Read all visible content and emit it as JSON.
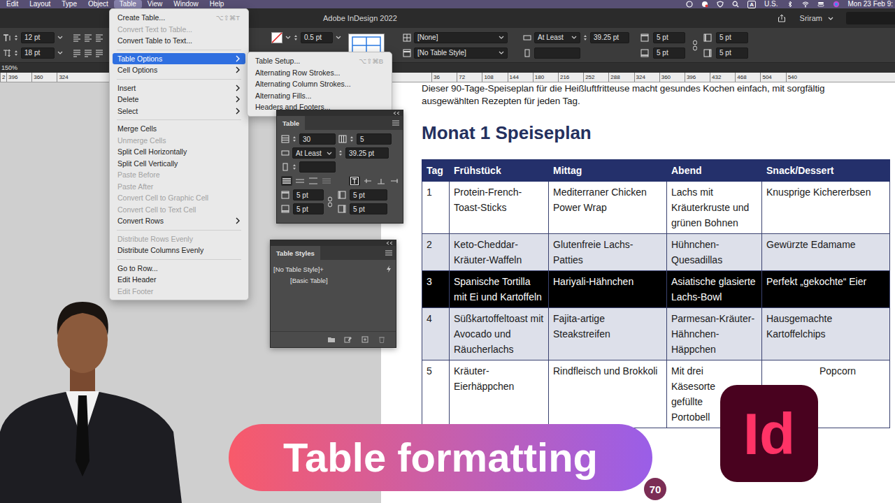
{
  "menubar": {
    "items": [
      {
        "label": "Edit",
        "selected": false
      },
      {
        "label": "Layout",
        "selected": false
      },
      {
        "label": "Type",
        "selected": false
      },
      {
        "label": "Object",
        "selected": false
      },
      {
        "label": "Table",
        "selected": true
      },
      {
        "label": "View",
        "selected": false
      },
      {
        "label": "Window",
        "selected": false
      },
      {
        "label": "Help",
        "selected": false
      }
    ],
    "status": {
      "input_source": "A",
      "locale": "U.S.",
      "clock": "Mon 23 Feb 9:"
    }
  },
  "app_bar": {
    "title": "Adobe InDesign 2022",
    "user": "Sriram"
  },
  "control_panel": {
    "font_size": "12 pt",
    "leading": "18 pt",
    "stroke_weight": "0.5 pt",
    "cell_style": "[None]",
    "table_style": "[No Table Style]",
    "row_height_mode": "At Least",
    "row_height": "39.25 pt",
    "row_height_max": "",
    "insets": [
      "5 pt",
      "5 pt",
      "5 pt",
      "5 pt"
    ]
  },
  "zoom": "150%",
  "ruler": {
    "left": [
      "2",
      "396",
      "360",
      "324"
    ],
    "right": [
      "36",
      "72",
      "108",
      "144",
      "180",
      "216",
      "252",
      "288",
      "324",
      "360",
      "396",
      "432",
      "468",
      "504",
      "540"
    ]
  },
  "table_menu": {
    "groups": [
      [
        {
          "label": "Create Table...",
          "shortcut": "⌥⇧⌘T",
          "disabled": false,
          "submenu": false,
          "selected": false
        },
        {
          "label": "Convert Text to Table...",
          "disabled": true,
          "submenu": false,
          "selected": false
        },
        {
          "label": "Convert Table to Text...",
          "disabled": false,
          "submenu": false,
          "selected": false
        }
      ],
      [
        {
          "label": "Table Options",
          "disabled": false,
          "submenu": true,
          "selected": true
        },
        {
          "label": "Cell Options",
          "disabled": false,
          "submenu": true,
          "selected": false
        }
      ],
      [
        {
          "label": "Insert",
          "disabled": false,
          "submenu": true,
          "selected": false
        },
        {
          "label": "Delete",
          "disabled": false,
          "submenu": true,
          "selected": false
        },
        {
          "label": "Select",
          "disabled": false,
          "submenu": true,
          "selected": false
        }
      ],
      [
        {
          "label": "Merge Cells",
          "disabled": false,
          "submenu": false,
          "selected": false
        },
        {
          "label": "Unmerge Cells",
          "disabled": true,
          "submenu": false,
          "selected": false
        },
        {
          "label": "Split Cell Horizontally",
          "disabled": false,
          "submenu": false,
          "selected": false
        },
        {
          "label": "Split Cell Vertically",
          "disabled": false,
          "submenu": false,
          "selected": false
        },
        {
          "label": "Paste Before",
          "disabled": true,
          "submenu": false,
          "selected": false
        },
        {
          "label": "Paste After",
          "disabled": true,
          "submenu": false,
          "selected": false
        },
        {
          "label": "Convert Cell to Graphic Cell",
          "disabled": true,
          "submenu": false,
          "selected": false
        },
        {
          "label": "Convert Cell to Text Cell",
          "disabled": true,
          "submenu": false,
          "selected": false
        },
        {
          "label": "Convert Rows",
          "disabled": false,
          "submenu": true,
          "selected": false
        }
      ],
      [
        {
          "label": "Distribute Rows Evenly",
          "disabled": true,
          "submenu": false,
          "selected": false
        },
        {
          "label": "Distribute Columns Evenly",
          "disabled": false,
          "submenu": false,
          "selected": false
        }
      ],
      [
        {
          "label": "Go to Row...",
          "disabled": false,
          "submenu": false,
          "selected": false
        },
        {
          "label": "Edit Header",
          "disabled": false,
          "submenu": false,
          "selected": false
        },
        {
          "label": "Edit Footer",
          "disabled": true,
          "submenu": false,
          "selected": false
        }
      ]
    ]
  },
  "table_options_submenu": {
    "items": [
      {
        "label": "Table Setup...",
        "shortcut": "⌥⇧⌘B",
        "selected": false
      },
      {
        "label": "Alternating Row Strokes...",
        "selected": false
      },
      {
        "label": "Alternating Column Strokes...",
        "selected": false
      },
      {
        "label": "Alternating Fills...",
        "selected": false
      },
      {
        "label": "Headers and Footers...",
        "selected": false
      }
    ]
  },
  "table_panel": {
    "title": "Table",
    "body_rows": "30",
    "columns": "5",
    "row_height_mode": "At Least",
    "row_height": "39.25 pt",
    "max_height": "",
    "insets": {
      "top": "5 pt",
      "bottom": "5 pt",
      "left": "5 pt",
      "right": "5 pt"
    }
  },
  "table_styles_panel": {
    "title": "Table Styles",
    "styles": [
      {
        "name": "[No Table Style]+",
        "selected": false
      },
      {
        "name": "[Basic Table]",
        "selected": false
      }
    ]
  },
  "document": {
    "intro": [
      "Dieser 90-Tage-Speiseplan für die Heißluftfritteuse macht gesundes Kochen einfach, mit sorgfältig",
      "ausgewählten Rezepten für jeden Tag."
    ],
    "heading": "Monat 1 Speiseplan",
    "table": {
      "columns": [
        "Tag",
        "Frühstück",
        "Mittag",
        "Abend",
        "Snack/Dessert"
      ],
      "rows": [
        {
          "cells": [
            "1",
            "Protein-French-Toast-Sticks",
            "Mediterraner Chicken Power Wrap",
            "Lachs mit Kräuterkruste und grünen Bohnen",
            "Knusprige Kichererbsen"
          ],
          "shaded": false,
          "selected": false
        },
        {
          "cells": [
            "2",
            "Keto-Cheddar-Kräuter-Waffeln",
            "Glutenfreie Lachs-Patties",
            "Hühnchen-Quesadillas",
            "Gewürzte Edamame"
          ],
          "shaded": true,
          "selected": false
        },
        {
          "cells": [
            "3",
            "Spanische Tortilla mit Ei und Kartoffeln",
            "Hariyali-Hähnchen",
            "Asiatische glasierte Lachs-Bowl",
            "Perfekt „gekochte“ Eier"
          ],
          "shaded": false,
          "selected": true
        },
        {
          "cells": [
            "4",
            "Süßkartoffeltoast mit Avocado und Räucherlachs",
            "Fajita-artige Steakstreifen",
            "Parmesan-Kräuter-Hähnchen-Häppchen",
            "Hausgemachte Kartoffelchips"
          ],
          "shaded": true,
          "selected": false
        },
        {
          "cells": [
            "5",
            "Kräuter-Eierhäppchen",
            "Rindfleisch und Brokkoli",
            "Mit drei\nKäsesorte\ngefüllte\nPortobell",
            "Popcorn"
          ],
          "shaded": false,
          "selected": false
        }
      ]
    },
    "page_number": "70"
  },
  "banner": {
    "text": "Table formatting"
  },
  "logo": {
    "text": "Id"
  }
}
